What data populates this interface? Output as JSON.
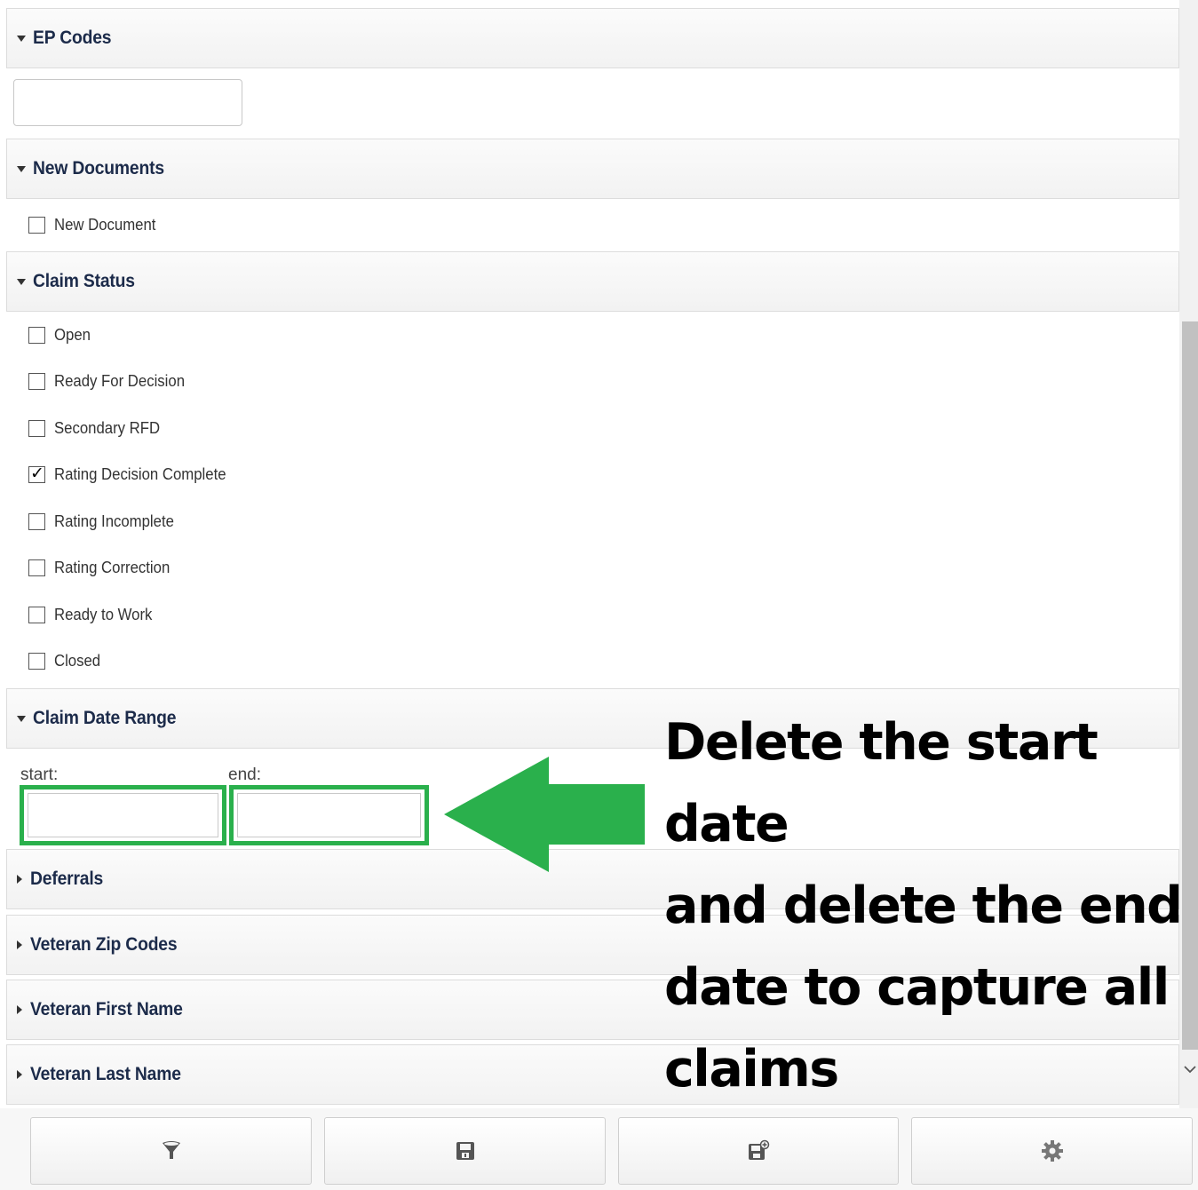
{
  "sections": {
    "ep_codes": {
      "title": "EP Codes",
      "input_value": ""
    },
    "new_documents": {
      "title": "New Documents",
      "options": [
        "New Document"
      ]
    },
    "claim_status": {
      "title": "Claim Status",
      "options": [
        {
          "label": "Open",
          "checked": false
        },
        {
          "label": "Ready For Decision",
          "checked": false
        },
        {
          "label": "Secondary RFD",
          "checked": false
        },
        {
          "label": "Rating Decision Complete",
          "checked": true
        },
        {
          "label": "Rating Incomplete",
          "checked": false
        },
        {
          "label": "Rating Correction",
          "checked": false
        },
        {
          "label": "Ready to Work",
          "checked": false
        },
        {
          "label": "Closed",
          "checked": false
        }
      ]
    },
    "claim_date_range": {
      "title": "Claim Date Range",
      "start_label": "start:",
      "end_label": "end:",
      "start_value": "",
      "end_value": ""
    },
    "deferrals": {
      "title": "Deferrals"
    },
    "veteran_zip_codes": {
      "title": "Veteran Zip Codes"
    },
    "veteran_first_name": {
      "title": "Veteran First Name"
    },
    "veteran_last_name": {
      "title": "Veteran Last Name"
    }
  },
  "annotation": {
    "lines": [
      "Delete the start date",
      "and delete the end",
      "date to capture all",
      "claims"
    ],
    "color": "#2ab04c"
  },
  "toolbar": {
    "buttons": [
      {
        "icon": "filter-icon"
      },
      {
        "icon": "save-icon"
      },
      {
        "icon": "save-as-icon"
      },
      {
        "icon": "gear-icon"
      }
    ]
  },
  "colors": {
    "header_text": "#1c2b4a",
    "highlight_green": "#2ab04c",
    "panel_header_bg": "#f5f5f5"
  }
}
